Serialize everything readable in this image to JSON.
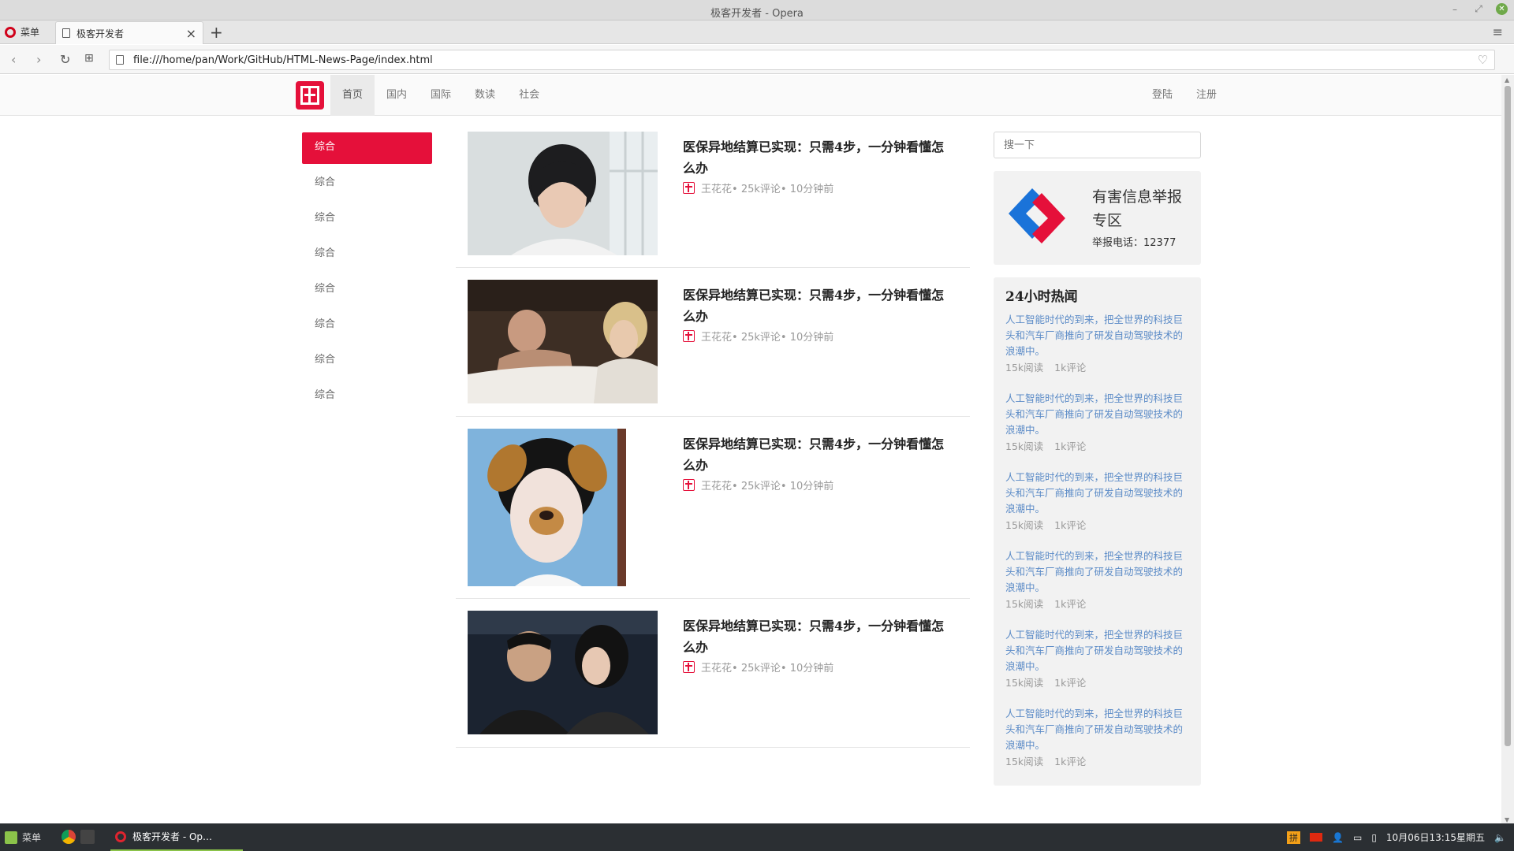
{
  "window": {
    "title": "极客开发者 - Opera"
  },
  "tabs": {
    "menu_label": "菜单",
    "active_tab_title": "极客开发者"
  },
  "address": {
    "url": "file:///home/pan/Work/GitHub/HTML-News-Page/index.html"
  },
  "site": {
    "nav": [
      "首页",
      "国内",
      "国际",
      "数读",
      "社会"
    ],
    "auth": {
      "login": "登陆",
      "register": "注册"
    },
    "sidenav": [
      "综合",
      "综合",
      "综合",
      "综合",
      "综合",
      "综合",
      "综合",
      "综合"
    ],
    "articles": [
      {
        "headline": "医保异地结算已实现：只需4步，一分钟看懂怎么办",
        "author": "王花花",
        "comments": "• 25k评论",
        "time": "• 10分钟前"
      },
      {
        "headline": "医保异地结算已实现：只需4步，一分钟看懂怎么办",
        "author": "王花花",
        "comments": "• 25k评论",
        "time": "• 10分钟前"
      },
      {
        "headline": "医保异地结算已实现：只需4步，一分钟看懂怎么办",
        "author": "王花花",
        "comments": "• 25k评论",
        "time": "• 10分钟前"
      },
      {
        "headline": "医保异地结算已实现：只需4步，一分钟看懂怎么办",
        "author": "王花花",
        "comments": "• 25k评论",
        "time": "• 10分钟前"
      }
    ],
    "search_placeholder": "搜一下",
    "report": {
      "title": "有害信息举报专区",
      "phone": "举报电话：12377"
    },
    "hot": {
      "title": "24小时热闻",
      "items": [
        {
          "text": "人工智能时代的到来，把全世界的科技巨头和汽车厂商推向了研发自动驾驶技术的浪潮中。",
          "reads": "15k阅读",
          "comments": "1k评论"
        },
        {
          "text": "人工智能时代的到来，把全世界的科技巨头和汽车厂商推向了研发自动驾驶技术的浪潮中。",
          "reads": "15k阅读",
          "comments": "1k评论"
        },
        {
          "text": "人工智能时代的到来，把全世界的科技巨头和汽车厂商推向了研发自动驾驶技术的浪潮中。",
          "reads": "15k阅读",
          "comments": "1k评论"
        },
        {
          "text": "人工智能时代的到来，把全世界的科技巨头和汽车厂商推向了研发自动驾驶技术的浪潮中。",
          "reads": "15k阅读",
          "comments": "1k评论"
        },
        {
          "text": "人工智能时代的到来，把全世界的科技巨头和汽车厂商推向了研发自动驾驶技术的浪潮中。",
          "reads": "15k阅读",
          "comments": "1k评论"
        },
        {
          "text": "人工智能时代的到来，把全世界的科技巨头和汽车厂商推向了研发自动驾驶技术的浪潮中。",
          "reads": "15k阅读",
          "comments": "1k评论"
        }
      ]
    }
  },
  "taskbar": {
    "menu_label": "菜单",
    "window_label": "极客开发者 - Op…",
    "ime": "拼",
    "clock": "10月06日13:15星期五"
  },
  "colors": {
    "brand": "#e5103a",
    "link": "#5b8bc7",
    "report_blue": "#1a73d9",
    "report_red": "#e5103a"
  }
}
